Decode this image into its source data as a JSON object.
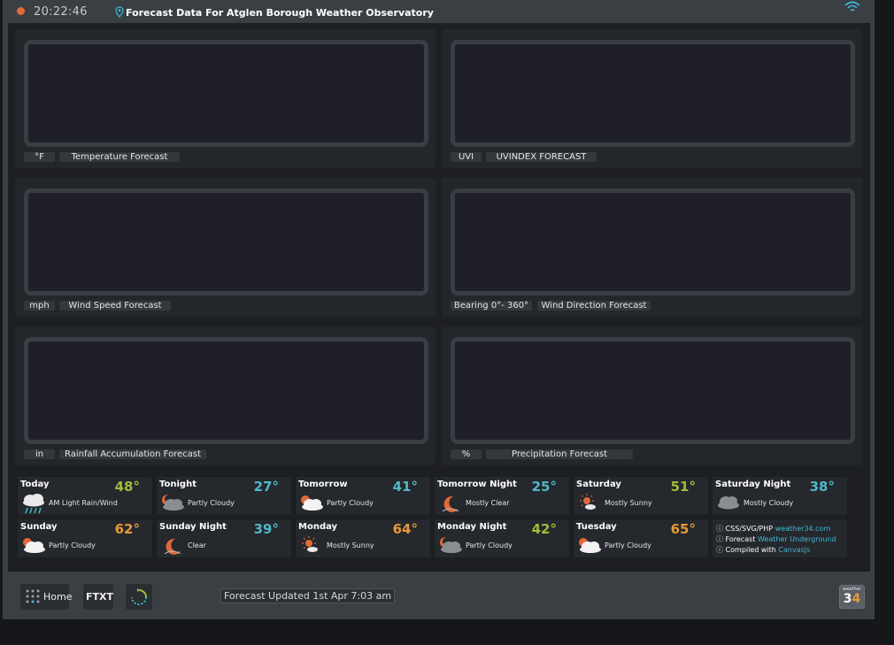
{
  "header": {
    "time": "20:22:46",
    "title": "Forecast Data For Atglen Borough Weather Observatory"
  },
  "panels": [
    {
      "unit": "°F",
      "name": "Temperature Forecast"
    },
    {
      "unit": "UVI",
      "name": "UVINDEX FORECAST"
    },
    {
      "unit": "mph",
      "name": "Wind Speed Forecast"
    },
    {
      "unit": "Bearing 0°- 360°",
      "name": "Wind Direction Forecast"
    },
    {
      "unit": "in",
      "name": "Rainfall Accumulation Forecast"
    },
    {
      "unit": "%",
      "name": "Precipitation Forecast"
    }
  ],
  "forecast": [
    {
      "period": "Today",
      "temp": "48°",
      "condition": "AM Light Rain/Wind",
      "icon": "rain-cloud-icon",
      "tone": "mild"
    },
    {
      "period": "Tonight",
      "temp": "27°",
      "condition": "Partly Cloudy",
      "icon": "partly-cloudy-night-icon",
      "tone": "cool"
    },
    {
      "period": "Tomorrow",
      "temp": "41°",
      "condition": "Partly Cloudy",
      "icon": "partly-cloudy-day-icon",
      "tone": "cool"
    },
    {
      "period": "Tomorrow Night",
      "temp": "25°",
      "condition": "Mostly Clear",
      "icon": "clear-night-icon",
      "tone": "cool"
    },
    {
      "period": "Saturday",
      "temp": "51°",
      "condition": "Mostly Sunny",
      "icon": "mostly-sunny-icon",
      "tone": "mild"
    },
    {
      "period": "Saturday Night",
      "temp": "38°",
      "condition": "Mostly Cloudy",
      "icon": "mostly-cloudy-night-icon",
      "tone": "cool"
    },
    {
      "period": "Sunday",
      "temp": "62°",
      "condition": "Partly Cloudy",
      "icon": "partly-cloudy-day-icon",
      "tone": "warm"
    },
    {
      "period": "Sunday Night",
      "temp": "39°",
      "condition": "Clear",
      "icon": "clear-night-icon",
      "tone": "cool"
    },
    {
      "period": "Monday",
      "temp": "64°",
      "condition": "Mostly Sunny",
      "icon": "mostly-sunny-icon",
      "tone": "warm"
    },
    {
      "period": "Monday Night",
      "temp": "42°",
      "condition": "Partly Cloudy",
      "icon": "partly-cloudy-night-icon",
      "tone": "mild"
    },
    {
      "period": "Tuesday",
      "temp": "65°",
      "condition": "Partly Cloudy",
      "icon": "partly-cloudy-day-icon",
      "tone": "warm"
    }
  ],
  "credits": {
    "line1_prefix": "CSS/SVG/PHP",
    "line1_link": "weather34.com",
    "line2_prefix": "Forecast",
    "line2_link": "Weather Underground",
    "line3_prefix": "Compiled with",
    "line3_link": "CanvasJs"
  },
  "footer": {
    "home_label": "Home",
    "ftxt_label": "FTXT",
    "update_text": "Forecast Updated 1st Apr 7:03 am",
    "logo_small": "weather",
    "logo_3": "3",
    "logo_4": "4"
  },
  "colors": {
    "accent_teal": "#3fb8d0",
    "warm": "#e59a3a",
    "cool": "#4fb8c8",
    "mild": "#9fbd3a",
    "record": "#e06a3a"
  }
}
